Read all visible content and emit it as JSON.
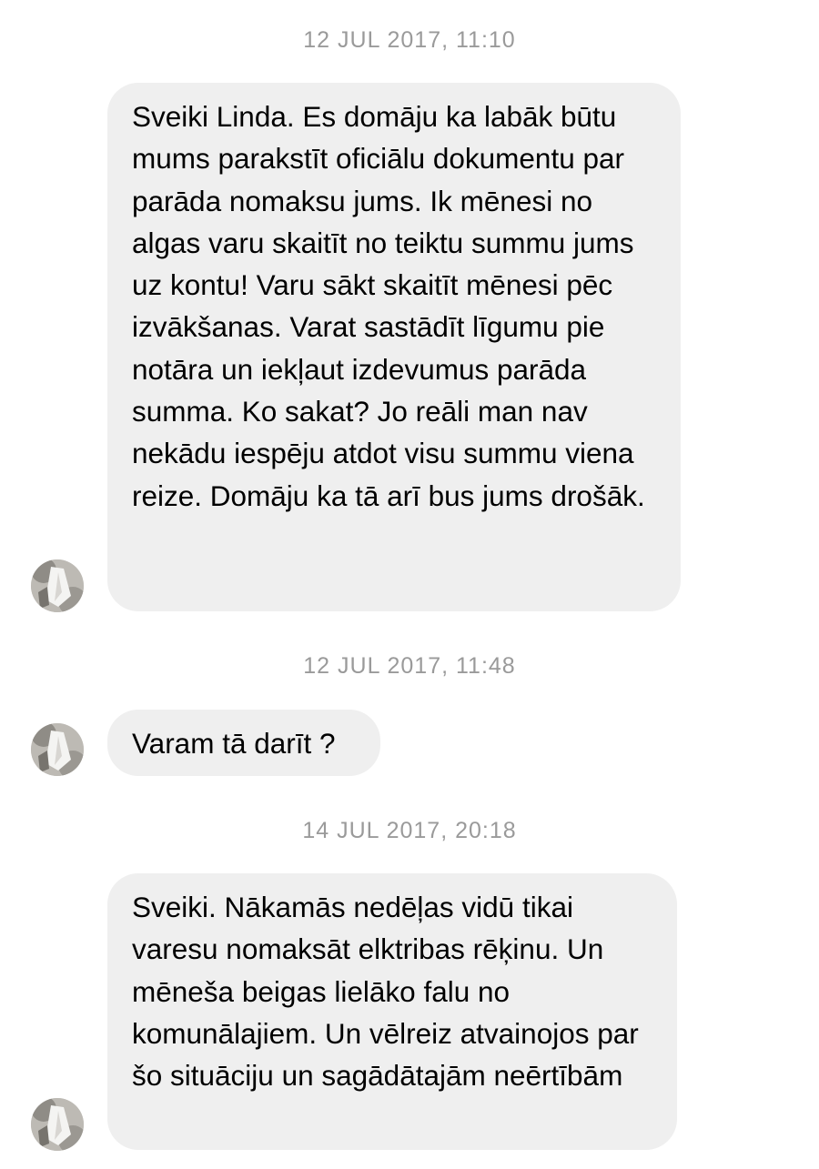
{
  "conversation": {
    "messages": [
      {
        "timestamp": "12 JUL 2017, 11:10",
        "text": "Sveiki Linda. Es domāju ka labāk būtu mums parakstīt oficiālu dokumentu par parāda nomaksu jums. Ik mēnesi no algas varu skaitīt no teiktu summu jums uz kontu! Varu sākt skaitīt mēnesi pēc izvākšanas. Varat sastādīt līgumu pie notāra un iekļaut izdevumus parāda summa. Ko sakat? Jo reāli man nav nekādu iespēju atdot visu summu viena reize.  Domāju ka tā arī bus jums drošāk."
      },
      {
        "timestamp": "12 JUL 2017, 11:48",
        "text": "Varam tā darīt ?"
      },
      {
        "timestamp": "14 JUL 2017, 20:18",
        "text": "Sveiki. Nākamās nedēļas vidū tikai varesu nomaksāt elktribas rēķinu. Un mēneša beigas lielāko falu no komunālajiem. Un vēlreiz atvainojos par šo situāciju un sagādātajām neērtībām"
      }
    ]
  },
  "avatar_icon": "user-avatar-photo"
}
